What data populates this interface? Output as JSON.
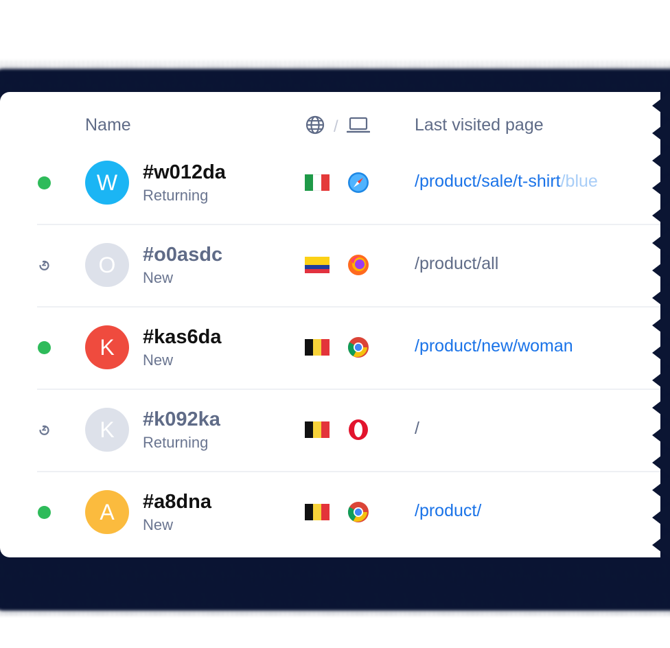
{
  "header": {
    "name_label": "Name",
    "separator": "/",
    "last_page_label": "Last visited page"
  },
  "colors": {
    "online": "#2ebb5a",
    "link": "#1a73e8",
    "muted": "#5f6b87",
    "avatar_inactive": "#dde1ea"
  },
  "visitors": [
    {
      "status": "online",
      "avatar_letter": "W",
      "avatar_color": "#1bb5f4",
      "id": "#w012da",
      "type": "Returning",
      "flag": "italy",
      "browser": "safari-icon",
      "page_main": "/product/sale/t-shirt",
      "page_fade": "/blue"
    },
    {
      "status": "away",
      "avatar_letter": "O",
      "avatar_color": "#dde1ea",
      "id": "#o0asdc",
      "type": "New",
      "flag": "colombia",
      "browser": "firefox-icon",
      "page_main": "/product/all",
      "page_fade": ""
    },
    {
      "status": "online",
      "avatar_letter": "K",
      "avatar_color": "#ef4b3e",
      "id": "#kas6da",
      "type": "New",
      "flag": "belgium",
      "browser": "chrome-icon",
      "page_main": "/product/new/woman",
      "page_fade": ""
    },
    {
      "status": "away",
      "avatar_letter": "K",
      "avatar_color": "#dde1ea",
      "id": "#k092ka",
      "type": "Returning",
      "flag": "belgium",
      "browser": "opera-icon",
      "page_main": "/",
      "page_fade": ""
    },
    {
      "status": "online",
      "avatar_letter": "A",
      "avatar_color": "#fbbb3e",
      "id": "#a8dna",
      "type": "New",
      "flag": "belgium",
      "browser": "chrome-icon",
      "page_main": "/product/",
      "page_fade": ""
    }
  ]
}
